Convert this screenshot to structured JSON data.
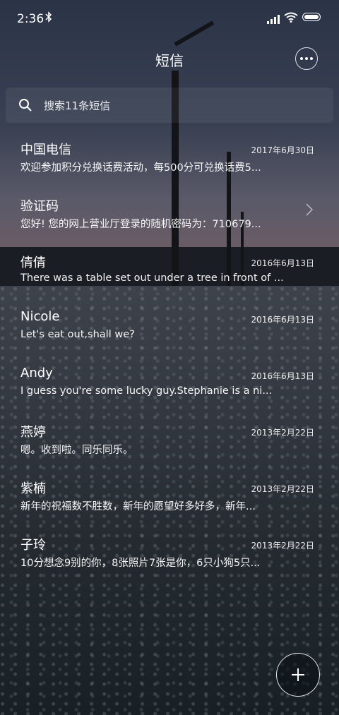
{
  "status_bar": {
    "time": "2:36"
  },
  "header": {
    "title": "短信"
  },
  "search": {
    "placeholder": "搜索11条短信"
  },
  "messages": [
    {
      "name": "中国电信",
      "date": "2017年6月30日",
      "preview": "欢迎参加积分兑换话费活动，每500分可兑换话费5..."
    },
    {
      "name": "验证码",
      "date": "",
      "preview": "您好! 您的网上营业厅登录的随机密码为：710679..."
    },
    {
      "name": "倩倩",
      "date": "2016年6月13日",
      "preview": "There was a table set out under a tree in front of ..."
    },
    {
      "name": "Nicole",
      "date": "2016年6月13日",
      "preview": "Let's eat out,shall we?"
    },
    {
      "name": "Andy",
      "date": "2016年6月13日",
      "preview": "I guess you're some lucky guy.Stephanie is a ni..."
    },
    {
      "name": "燕婷",
      "date": "2013年2月22日",
      "preview": "嗯。收到啦。同乐同乐。"
    },
    {
      "name": "紫楠",
      "date": "2013年2月22日",
      "preview": "新年的祝福数不胜数，新年的愿望好多好多，新年..."
    },
    {
      "name": "子玲",
      "date": "2013年2月22日",
      "preview": "10分想念9别的你，8张照片7张是你，6只小狗5只..."
    }
  ]
}
